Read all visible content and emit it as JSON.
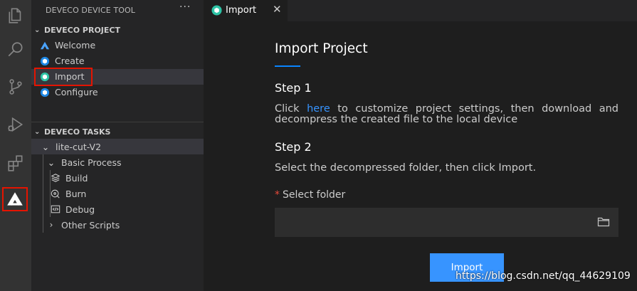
{
  "sidebar": {
    "title": "DEVECO DEVICE TOOL",
    "more": "···",
    "project_section": {
      "title": "DEVECO PROJECT",
      "items": [
        {
          "label": "Welcome",
          "icon": "deveco-logo-icon"
        },
        {
          "label": "Create",
          "icon": "cube-icon"
        },
        {
          "label": "Import",
          "icon": "cube-icon",
          "selected": true
        },
        {
          "label": "Configure",
          "icon": "cube-icon"
        }
      ]
    },
    "tasks_section": {
      "title": "DEVECO TASKS",
      "project": "lite-cut-V2",
      "group": "Basic Process",
      "tasks": [
        {
          "label": "Build",
          "icon": "layers-icon"
        },
        {
          "label": "Burn",
          "icon": "burn-icon"
        },
        {
          "label": "Debug",
          "icon": "code-icon"
        }
      ],
      "other": "Other Scripts"
    }
  },
  "tab": {
    "label": "Import",
    "close": "✕"
  },
  "main": {
    "title": "Import Project",
    "step1": {
      "heading": "Step 1",
      "prefix": "Click ",
      "link": "here",
      "suffix": " to customize project settings, then download and decompress the created file to the local device"
    },
    "step2": {
      "heading": "Step 2",
      "text": "Select the decompressed folder, then click Import."
    },
    "folder_field": {
      "required_mark": "*",
      "label": "Select folder",
      "value": ""
    },
    "import_button": "Import"
  },
  "watermark": "https://blog.csdn.net/qq_44629109",
  "colors": {
    "accent": "#3794ff",
    "highlight_box": "#e51400",
    "activity_bar": "#333333",
    "sidebar": "#252526",
    "editor": "#1e1e1e"
  }
}
